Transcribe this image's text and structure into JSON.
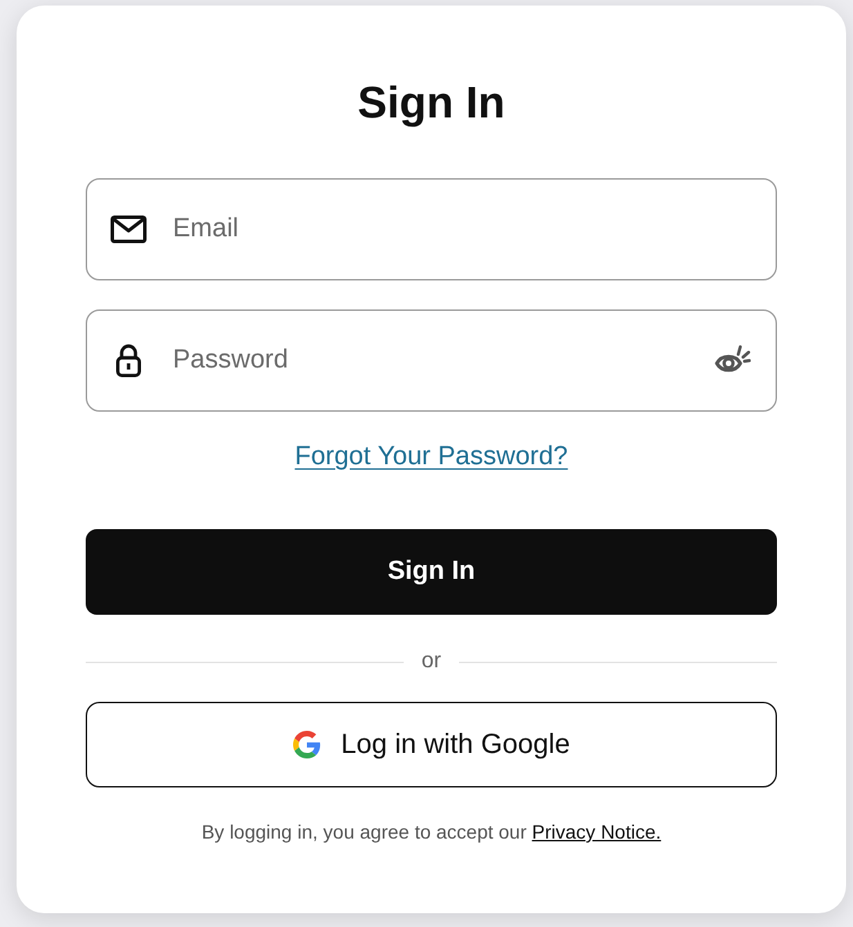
{
  "title": "Sign In",
  "fields": [
    {
      "kind": "email",
      "placeholder": "Email"
    },
    {
      "kind": "password",
      "placeholder": "Password",
      "reveal_toggle": true
    }
  ],
  "forgot_link": "Forgot Your Password?",
  "primary_button": "Sign In",
  "divider": "or",
  "google_button": "Log in with Google",
  "footer": {
    "text": "By logging in, you agree to accept our",
    "link": "Privacy Notice."
  }
}
